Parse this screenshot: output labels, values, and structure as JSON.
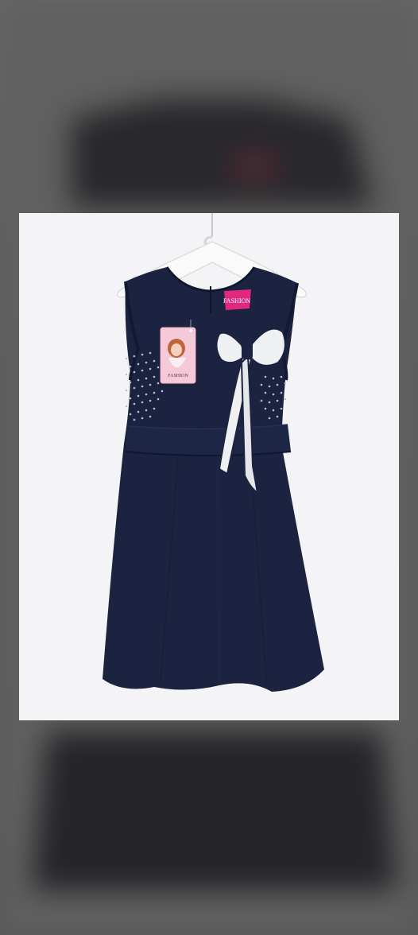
{
  "colors": {
    "background_outer": "#5e5e5e",
    "photo_background": "#f4f4f6",
    "dress_navy": "#1b2340",
    "dress_navy_dark": "#121a32",
    "bow_white": "#eef0f2",
    "tag_pink": "#f4c9d8",
    "label_magenta": "#e0287e",
    "hanger_white": "#fafafa"
  },
  "product": {
    "hang_tag_text": "FASHION",
    "neck_label_text": "FASHION"
  },
  "icons": {
    "hanger": "hanger-icon",
    "bow": "bow-decoration",
    "tag": "hang-tag"
  }
}
